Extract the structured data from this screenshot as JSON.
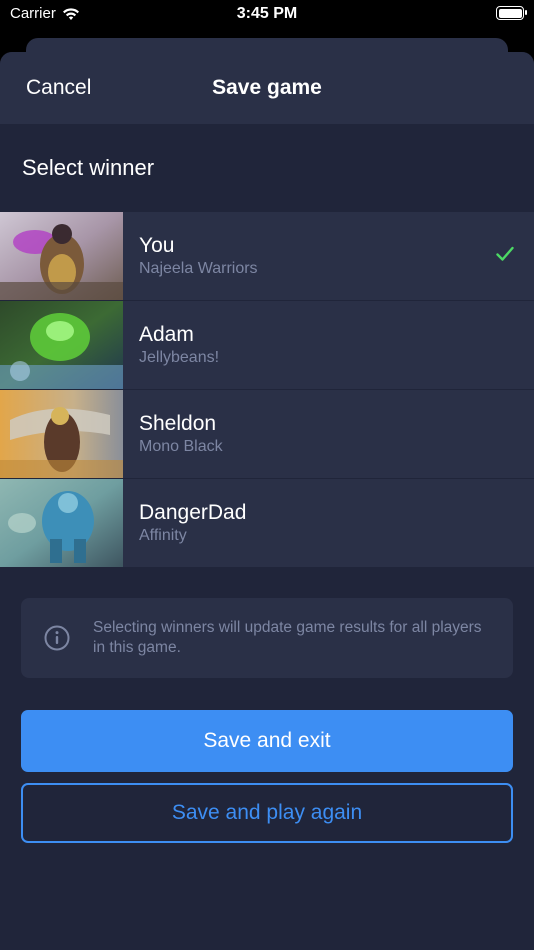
{
  "status_bar": {
    "carrier": "Carrier",
    "time": "3:45 PM",
    "wifi_icon": "wifi-icon",
    "battery_icon": "battery-icon"
  },
  "nav": {
    "cancel_label": "Cancel",
    "title": "Save game"
  },
  "section": {
    "title": "Select winner"
  },
  "players": [
    {
      "name": "You",
      "deck": "Najeela Warriors",
      "selected": true
    },
    {
      "name": "Adam",
      "deck": "Jellybeans!",
      "selected": false
    },
    {
      "name": "Sheldon",
      "deck": "Mono Black",
      "selected": false
    },
    {
      "name": "DangerDad",
      "deck": "Affinity",
      "selected": false
    }
  ],
  "info": {
    "icon": "info-icon",
    "text": "Selecting winners will update game results for all players in this game."
  },
  "buttons": {
    "save_exit": "Save and exit",
    "save_play_again": "Save and play again"
  },
  "colors": {
    "background": "#20253a",
    "row": "#2a3047",
    "accent": "#3d8ef3",
    "check": "#4cd964",
    "muted_text": "#7d86a3"
  }
}
